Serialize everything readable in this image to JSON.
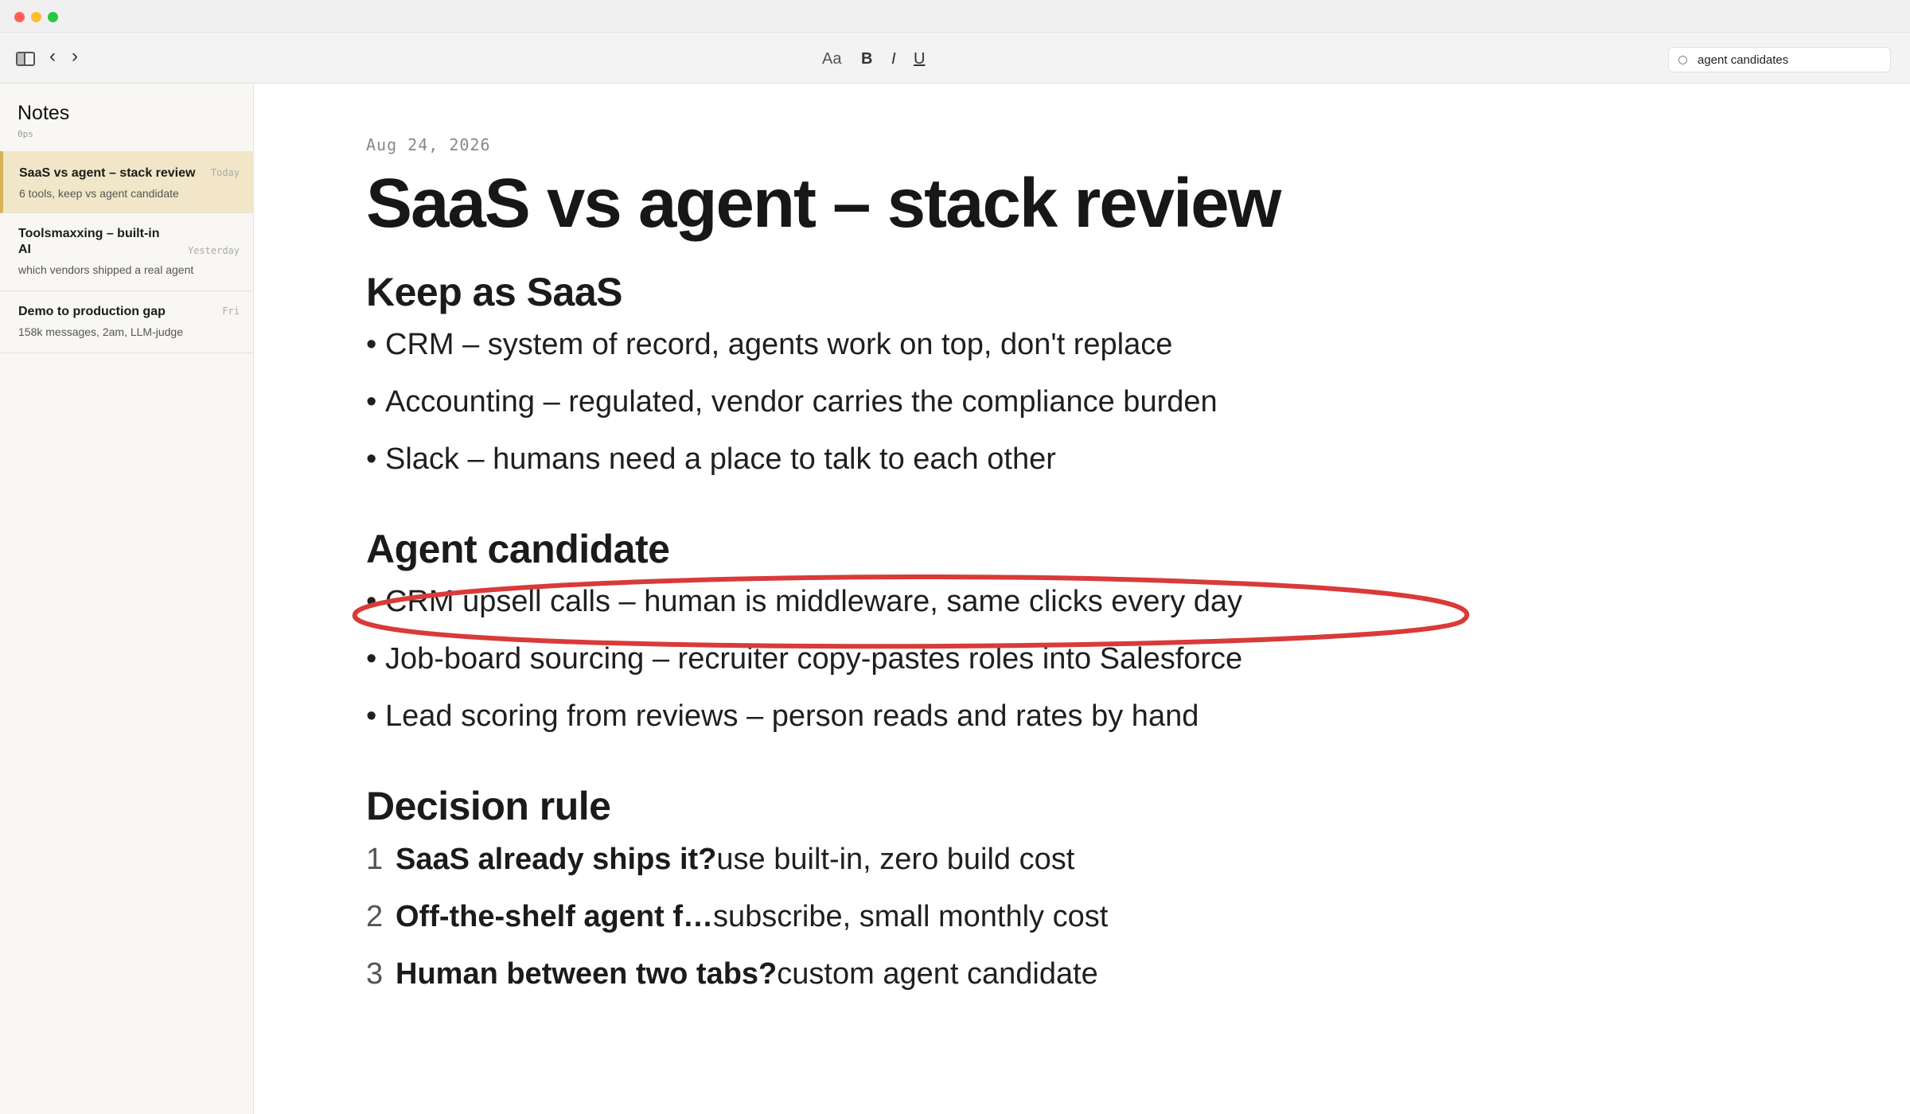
{
  "toolbar": {
    "format_buttons": [
      "Aa",
      "B",
      "I",
      "U"
    ],
    "search": {
      "value": "agent candidates",
      "placeholder": ""
    }
  },
  "sidebar": {
    "title": "Notes",
    "subtitle": "0ps",
    "notes": [
      {
        "title": "SaaS vs agent – stack review",
        "date": "Today",
        "preview": "6 tools, keep vs agent candidate",
        "active": true
      },
      {
        "title": "Toolsmaxxing – built-in AI",
        "title_line1": "Toolsmaxxing – built-in",
        "title_line2": "AI",
        "date": "Yesterday",
        "preview": "which vendors shipped a real agent"
      },
      {
        "title": "Demo to production gap",
        "date": "Fri",
        "preview": "158k messages, 2am, LLM-judge"
      }
    ]
  },
  "document": {
    "date": "Aug 24, 2026",
    "title": "SaaS vs agent – stack review",
    "sections": [
      {
        "heading": "Keep as SaaS",
        "bullets": [
          "CRM – system of record, agents work on top, don't replace",
          "Accounting – regulated, vendor carries the compliance burden",
          "Slack – humans need a place to talk to each other"
        ]
      },
      {
        "heading": "Agent candidate",
        "bullets": [
          "CRM upsell calls – human is middleware, same clicks every day",
          "Job-board sourcing – recruiter copy-pastes roles into Salesforce",
          "Lead scoring from reviews – person reads and rates by hand"
        ]
      },
      {
        "heading": "Decision rule",
        "items": [
          {
            "num": "1",
            "bold": "SaaS already ships it?",
            "rest": "use built-in, zero build cost"
          },
          {
            "num": "2",
            "bold": "Off-the-shelf agent f…",
            "rest": "subscribe, small monthly cost"
          },
          {
            "num": "3",
            "bold": "Human between two tabs?",
            "rest": "custom agent candidate"
          }
        ]
      }
    ],
    "bullet_glyph": "•"
  },
  "colors": {
    "annotation": "#d93a3a",
    "active_note_bg": "#f1e7c8",
    "active_note_border": "#d6b35a"
  }
}
